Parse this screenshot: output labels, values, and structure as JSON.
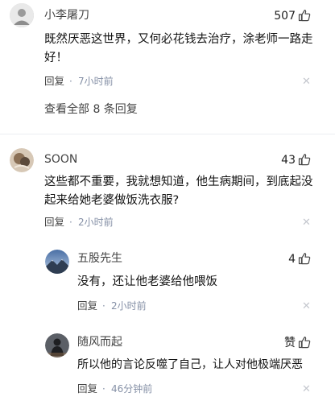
{
  "comments": [
    {
      "username": "小李屠刀",
      "likes": "507",
      "text_line1": "既然厌恶这世界，又何必花钱去治疗，涂老师一路走",
      "text_line2": "好！",
      "reply_label": "回复",
      "time": "7小时前",
      "expand_label": "查看全部 8 条回复"
    },
    {
      "username": "SOON",
      "likes": "43",
      "text_line1": "这些都不重要，我就想知道，他生病期间，到底起没",
      "text_line2": "起来给她老婆做饭洗衣服?",
      "reply_label": "回复",
      "time": "2小时前",
      "replies": [
        {
          "username": "五股先生",
          "likes": "4",
          "text": "没有，还让他老婆给他喂饭",
          "reply_label": "回复",
          "time": "2小时前"
        },
        {
          "username": "随风而起",
          "likes": "赞",
          "text": "所以他的言论反噬了自己，让人对他极端厌恶",
          "reply_label": "回复",
          "time": "46分钟前"
        }
      ]
    }
  ],
  "colors": {
    "meta": "#8590a6",
    "text": "#121212"
  },
  "icons": {
    "like": "thumbs-up-icon",
    "close": "close-icon",
    "dot": "dot-separator"
  }
}
